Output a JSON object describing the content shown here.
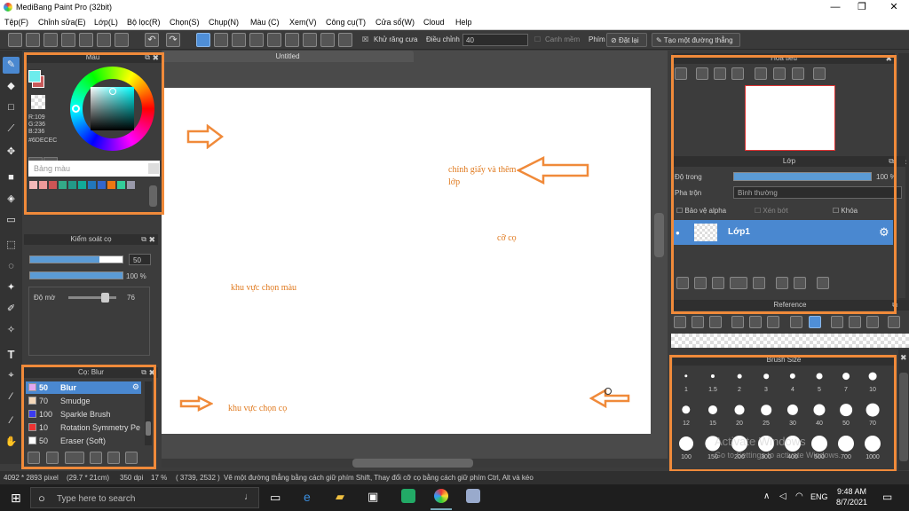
{
  "app": {
    "title": "MediBang Paint Pro (32bit)"
  },
  "menu": [
    "Tệp(F)",
    "Chỉnh sửa(E)",
    "Lớp(L)",
    "Bộ lọc(R)",
    "Chọn(S)",
    "Chụp(N)",
    "Màu (C)",
    "Xem(V)",
    "Công cụ(T)",
    "Cửa sổ(W)",
    "Cloud",
    "Help"
  ],
  "toolbar": {
    "antialias_label": "Khử răng cưa",
    "adjust_label": "Điều chỉnh",
    "adjust_value": "40",
    "snap_label": "Canh mềm",
    "key_label": "Phím",
    "set_label": "Đặt lại",
    "line_label": "Tạo một đường thẳng"
  },
  "color_panel": {
    "title": "Màu",
    "r": "R:109",
    "g": "G:236",
    "b": "B:236",
    "hex": "#6DECEC",
    "palette_label": "Bảng màu",
    "palette_colors": [
      "#f4b8b8",
      "#e99",
      "#c55",
      "#3a8",
      "#298",
      "#1a9",
      "#27b",
      "#36c",
      "#e71",
      "#3c9",
      "#99a"
    ],
    "primary": "#6DECEC",
    "secondary": "#c85a5a"
  },
  "brush_control": {
    "title": "Kiểm soát cọ",
    "size_value": "50",
    "opacity_value": "100 %",
    "blur_label": "Độ mờ",
    "blur_value": "76",
    "size_fraction": 0.75,
    "opacity_fraction": 1.0,
    "blur_fraction": 0.76
  },
  "brush_panel": {
    "title": "Cọ: Blur",
    "items": [
      {
        "size": "50",
        "name": "Blur",
        "color": "#e2a6f0"
      },
      {
        "size": "70",
        "name": "Smudge",
        "color": "#f4d7b8"
      },
      {
        "size": "100",
        "name": "Sparkle Brush",
        "color": "#3b3bf0"
      },
      {
        "size": "10",
        "name": "Rotation Symmetry Pe",
        "color": "#e33"
      },
      {
        "size": "50",
        "name": "Eraser (Soft)",
        "color": "#fff"
      }
    ]
  },
  "document": {
    "tab": "Untitled"
  },
  "notes": {
    "paper": "chỉnh giấy và thêm",
    "layer": "lớp",
    "brush": "cỡ cọ",
    "color": "khu vực chọn màu",
    "brush_area": "khu vực chọn cọ"
  },
  "navigator": {
    "title": "Hoa tiêu"
  },
  "layer_panel": {
    "title": "Lớp",
    "opacity_label": "Độ trong",
    "opacity_value": "100 %",
    "blend_label": "Pha trộn",
    "blend_value": "Bình thường",
    "protect_alpha": "Bảo vệ alpha",
    "clip": "Xén bớt",
    "lock": "Khóa",
    "layer_name": "Lớp1"
  },
  "reference": {
    "title": "Reference"
  },
  "brush_size": {
    "title": "Brush Size",
    "sizes": [
      "1",
      "1.5",
      "2",
      "3",
      "4",
      "5",
      "7",
      "10",
      "12",
      "15",
      "20",
      "25",
      "30",
      "40",
      "50",
      "70",
      "100",
      "150",
      "200",
      "300",
      "400",
      "500",
      "700",
      "1000"
    ]
  },
  "watermark": {
    "line1": "Activate Windows",
    "line2": "Go to Settings to activate Windows."
  },
  "status": {
    "dims": "4092 * 2893 pixel",
    "size": "(29.7 * 21cm)",
    "dpi": "350 dpi",
    "zoom": "17 %",
    "coords": "( 3739, 2532 )",
    "hint": "Vẽ một đường thẳng bằng cách giữ phím Shift, Thay đổi cỡ cọ bằng cách giữ phím Ctrl, Alt và kéo"
  },
  "taskbar": {
    "search_placeholder": "Type here to search",
    "lang": "ENG",
    "time": "9:48 AM",
    "date": "8/7/2021"
  }
}
